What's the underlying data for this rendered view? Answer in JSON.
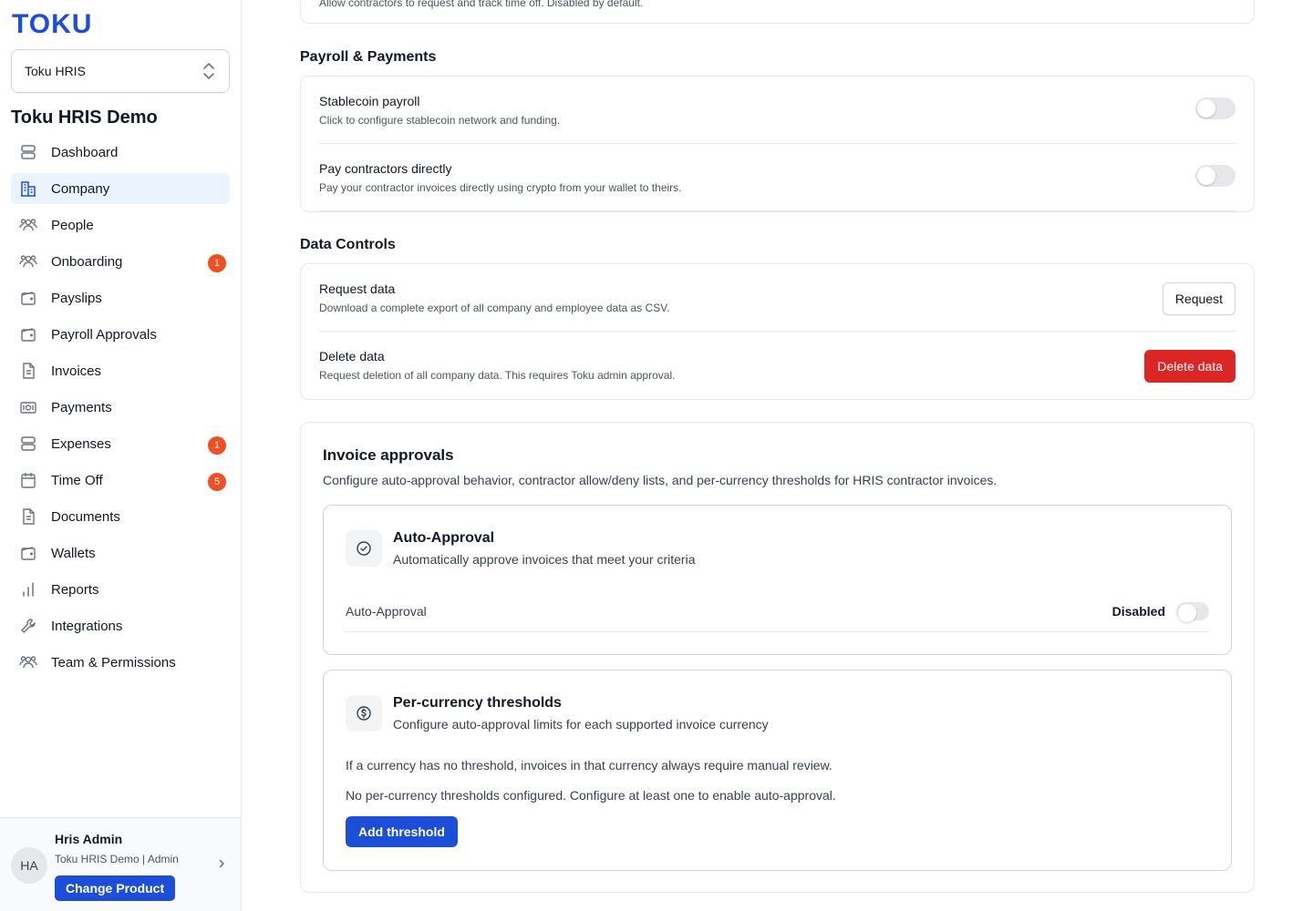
{
  "sidebar": {
    "logo": "TOKU",
    "product_select": "Toku HRIS",
    "company_name": "Toku HRIS Demo",
    "items": [
      {
        "label": "Dashboard",
        "icon": "dashboard-icon"
      },
      {
        "label": "Company",
        "icon": "building-icon",
        "active": true
      },
      {
        "label": "People",
        "icon": "people-icon"
      },
      {
        "label": "Onboarding",
        "icon": "onboarding-icon",
        "badge": "1"
      },
      {
        "label": "Payslips",
        "icon": "wallet-icon"
      },
      {
        "label": "Payroll Approvals",
        "icon": "wallet-icon"
      },
      {
        "label": "Invoices",
        "icon": "document-icon"
      },
      {
        "label": "Payments",
        "icon": "banknote-icon"
      },
      {
        "label": "Expenses",
        "icon": "expenses-icon",
        "badge": "1"
      },
      {
        "label": "Time Off",
        "icon": "calendar-icon",
        "badge": "5"
      },
      {
        "label": "Documents",
        "icon": "document-icon"
      },
      {
        "label": "Wallets",
        "icon": "wallet-icon"
      },
      {
        "label": "Reports",
        "icon": "bar-chart-icon"
      },
      {
        "label": "Integrations",
        "icon": "wrench-icon"
      },
      {
        "label": "Team & Permissions",
        "icon": "people-icon"
      }
    ],
    "user": {
      "initials": "HA",
      "name": "Hris Admin",
      "sub": "Toku HRIS Demo | Admin",
      "change_product": "Change Product"
    }
  },
  "top_partial": {
    "desc": "Allow contractors to request and track time off. Disabled by default."
  },
  "payroll": {
    "title": "Payroll & Payments",
    "rows": [
      {
        "title": "Stablecoin payroll",
        "desc": "Click to configure stablecoin network and funding."
      },
      {
        "title": "Pay contractors directly",
        "desc": "Pay your contractor invoices directly using crypto from your wallet to theirs."
      }
    ]
  },
  "data_controls": {
    "title": "Data Controls",
    "request": {
      "title": "Request data",
      "desc": "Download a complete export of all company and employee data as CSV.",
      "button": "Request"
    },
    "delete": {
      "title": "Delete data",
      "desc": "Request deletion of all company data. This requires Toku admin approval.",
      "button": "Delete data"
    }
  },
  "invoice_approvals": {
    "title": "Invoice approvals",
    "desc": "Configure auto-approval behavior, contractor allow/deny lists, and per-currency thresholds for HRIS contractor invoices.",
    "auto_approval": {
      "title": "Auto-Approval",
      "desc": "Automatically approve invoices that meet your criteria",
      "row_label": "Auto-Approval",
      "status": "Disabled"
    },
    "thresholds": {
      "title": "Per-currency thresholds",
      "desc": "Configure auto-approval limits for each supported invoice currency",
      "note1": "If a currency has no threshold, invoices in that currency always require manual review.",
      "note2": "No per-currency thresholds configured. Configure at least one to enable auto-approval.",
      "button": "Add threshold"
    }
  },
  "colors": {
    "brand": "#1d4ed8",
    "danger": "#dc2626",
    "badge": "#f04e23",
    "active_bg": "#eaf3ff"
  }
}
